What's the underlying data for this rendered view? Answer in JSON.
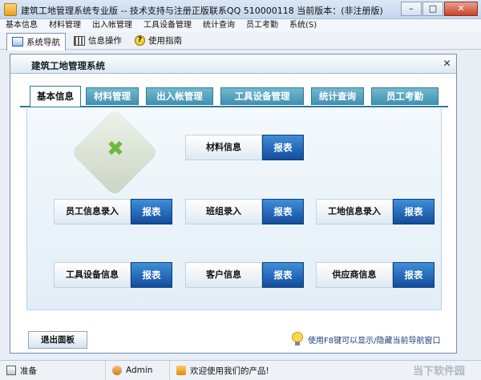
{
  "window": {
    "title": "建筑工地管理系统专业版 -- 技术支持与注册正版联系QQ 510000118    当前版本：(非注册版)",
    "minimize": "–",
    "maximize": "□",
    "close": "✕"
  },
  "menubar": [
    "基本信息",
    "材料管理",
    "出入帐管理",
    "工具设备管理",
    "统计查询",
    "员工考勤",
    "系统(S)"
  ],
  "toolbar": {
    "nav_label": "系统导航",
    "info_label": "信息操作",
    "help_label": "使用指南"
  },
  "panel": {
    "title": "建筑工地管理系统",
    "close": "✕"
  },
  "tabs": [
    "基本信息",
    "材料管理",
    "出入帐管理",
    "工具设备管理",
    "统计查询",
    "员工考勤"
  ],
  "active_tab": "基本信息",
  "cards": {
    "material_info": "材料信息",
    "employee_entry": "员工信息录入",
    "team_entry": "班组录入",
    "site_entry": "工地信息录入",
    "tool_info": "工具设备信息",
    "customer_info": "客户信息",
    "supplier_info": "供应商信息",
    "report_label": "报表"
  },
  "bottom": {
    "exit_label": "退出面板",
    "hint": "使用F8键可以显示/隐藏当前导航窗口"
  },
  "statusbar": {
    "ready": "准备",
    "user": "Admin",
    "welcome": "欢迎使用我们的产品!"
  },
  "watermark": "当下软件园",
  "colors": {
    "tab_bg": "#3d8fb0",
    "report_button": "#134c9c",
    "title_bar": "#c5d7ec"
  }
}
